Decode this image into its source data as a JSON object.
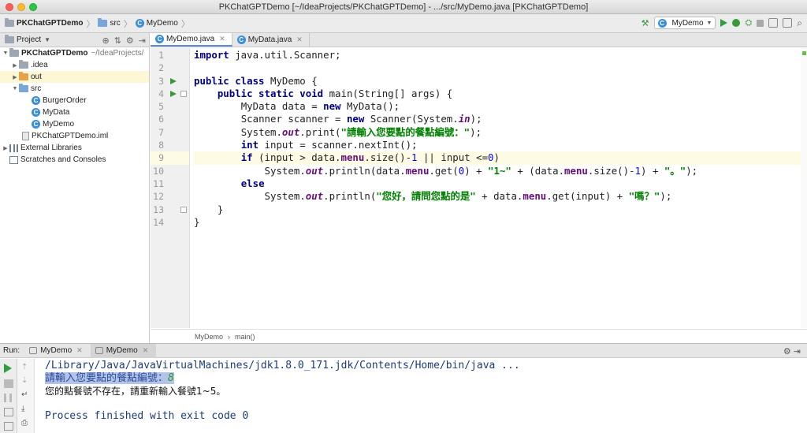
{
  "window": {
    "title": "PKChatGPTDemo [~/IdeaProjects/PKChatGPTDemo] - .../src/MyDemo.java [PKChatGPTDemo]"
  },
  "breadcrumbs": [
    "PKChatGPTDemo",
    "src",
    "MyDemo"
  ],
  "toolbar": {
    "run_config": "MyDemo"
  },
  "project_panel": {
    "header": "Project",
    "tree": [
      {
        "label": "PKChatGPTDemo",
        "extra": "~/IdeaProjects/"
      },
      {
        "label": ".idea"
      },
      {
        "label": "out"
      },
      {
        "label": "src"
      },
      {
        "label": "BurgerOrder"
      },
      {
        "label": "MyData"
      },
      {
        "label": "MyDemo"
      },
      {
        "label": "PKChatGPTDemo.iml"
      },
      {
        "label": "External Libraries"
      },
      {
        "label": "Scratches and Consoles"
      }
    ]
  },
  "editor": {
    "tabs": [
      "MyDemo.java",
      "MyData.java"
    ],
    "line_numbers": [
      "1",
      "2",
      "3",
      "4",
      "5",
      "6",
      "7",
      "8",
      "9",
      "10",
      "11",
      "12",
      "13",
      "14"
    ],
    "status_breadcrumb": [
      "MyDemo",
      "main()"
    ]
  },
  "code": {
    "l1_kw": "import",
    "l1_rest": " java.util.Scanner;",
    "l3_kw": "public class",
    "l3_rest": " MyDemo {",
    "l4_kw": "public static void",
    "l4_rest": " main(String[] args) {",
    "l5_a": "MyData data = ",
    "l5_kw": "new",
    "l5_b": " MyData();",
    "l6_a": "Scanner scanner = ",
    "l6_kw": "new",
    "l6_b": " Scanner(System.",
    "l6_in": "in",
    "l6_c": ");",
    "l7_a": "System.",
    "l7_out": "out",
    "l7_b": ".print(",
    "l7_str": "\"請輸入您要點的餐點編號：\"",
    "l7_c": ");",
    "l8_kw": "int",
    "l8_rest": " input = scanner.nextInt();",
    "l9_kw": "if",
    "l9_a": " (input > data.",
    "l9_menu": "menu",
    "l9_b": ".size()-",
    "l9_n1": "1",
    "l9_c": " || input <=",
    "l9_n0": "0",
    "l9_d": ")",
    "l10_a": "System.",
    "l10_out": "out",
    "l10_b": ".println(data.",
    "l10_menu1": "menu",
    "l10_c": ".get(",
    "l10_n0": "0",
    "l10_d": ") + ",
    "l10_s1": "\"1~\"",
    "l10_e": " + (data.",
    "l10_menu2": "menu",
    "l10_f": ".size()-",
    "l10_n1": "1",
    "l10_g": ") + ",
    "l10_s2": "\"。\"",
    "l10_h": ");",
    "l11_kw": "else",
    "l12_a": "System.",
    "l12_out": "out",
    "l12_b": ".println(",
    "l12_s1": "\"您好，請問您點的是\"",
    "l12_c": " + data.",
    "l12_menu": "menu",
    "l12_d": ".get(input) + ",
    "l12_s2": "\"嗎？\"",
    "l12_e": ");",
    "l13": "}",
    "l14": "}"
  },
  "run_panel": {
    "label": "Run:",
    "tabs": [
      "MyDemo",
      "MyDemo"
    ],
    "console": {
      "path": "/Library/Java/JavaVirtualMachines/jdk1.8.0_171.jdk/Contents/Home/bin/java ...",
      "prompt": "請輸入您要點的餐點編號：",
      "user_input": "8",
      "message": "您的點餐號不存在，請重新輸入餐號1~5。",
      "finished": "Process finished with exit code 0"
    }
  }
}
